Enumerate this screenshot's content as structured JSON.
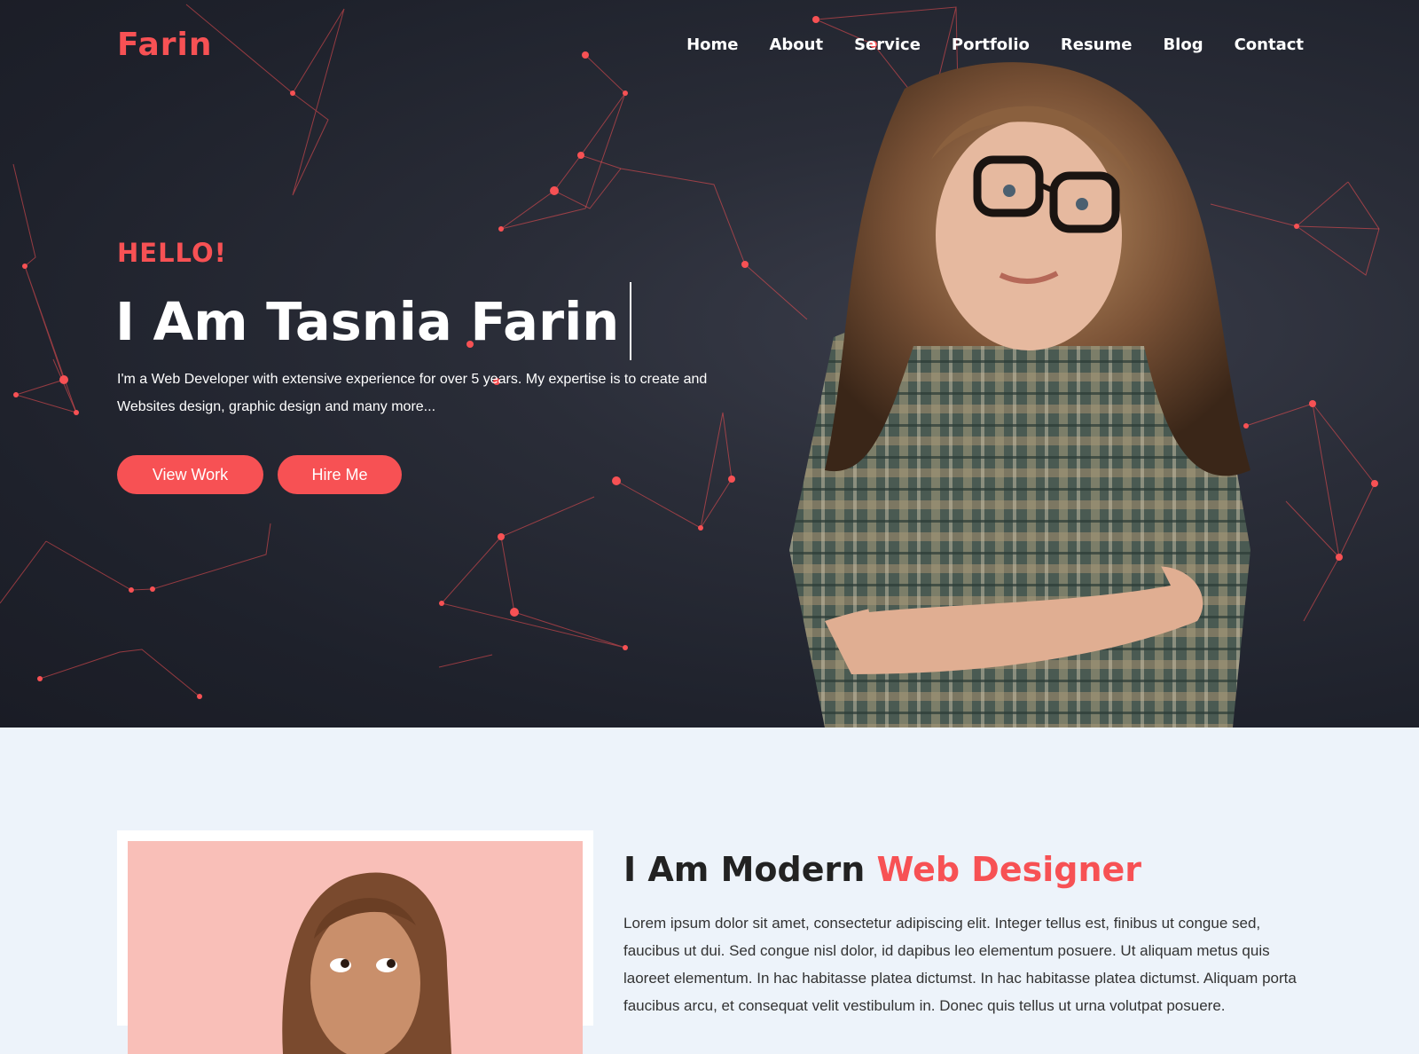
{
  "brand": "Farin",
  "nav": [
    "Home",
    "About",
    "Service",
    "Portfolio",
    "Resume",
    "Blog",
    "Contact"
  ],
  "hero": {
    "greeting": "HELLO!",
    "headline": "I Am Tasnia Farin",
    "intro": "I'm a Web Developer with extensive experience for over 5 years. My expertise is to create and Websites design, graphic design and many more...",
    "buttons": {
      "view": "View Work",
      "hire": "Hire Me"
    }
  },
  "about": {
    "title_main": "I Am Modern ",
    "title_accent": "Web Designer",
    "text": "Lorem ipsum dolor sit amet, consectetur adipiscing elit. Integer tellus est, finibus ut congue sed, faucibus ut dui. Sed congue nisl dolor, id dapibus leo elementum posuere. Ut aliquam metus quis laoreet elementum. In hac habitasse platea dictumst. In hac habitasse platea dictumst. Aliquam porta faucibus arcu, et consequat velit vestibulum in. Donec quis tellus ut urna volutpat posuere."
  },
  "colors": {
    "accent": "#f75154",
    "hero_bg": "#1e212b",
    "about_bg": "#edf3fa"
  }
}
